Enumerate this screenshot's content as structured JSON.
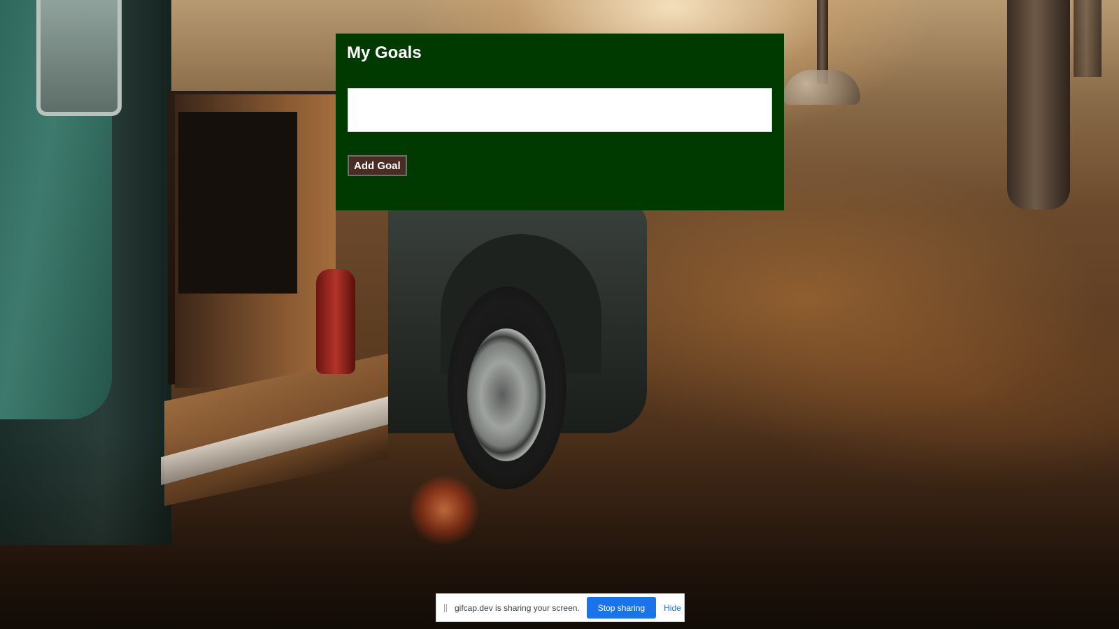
{
  "goals": {
    "title": "My Goals",
    "input_value": "",
    "input_placeholder": "",
    "add_button_label": "Add Goal"
  },
  "share_bar": {
    "message": "gifcap.dev is sharing your screen.",
    "stop_label": "Stop sharing",
    "hide_label": "Hide"
  },
  "colors": {
    "panel_background": "#003a00",
    "button_background": "#4b2c22",
    "share_button": "#1a73e8"
  },
  "icons": {
    "share_drag_handle": "grip-icon"
  }
}
